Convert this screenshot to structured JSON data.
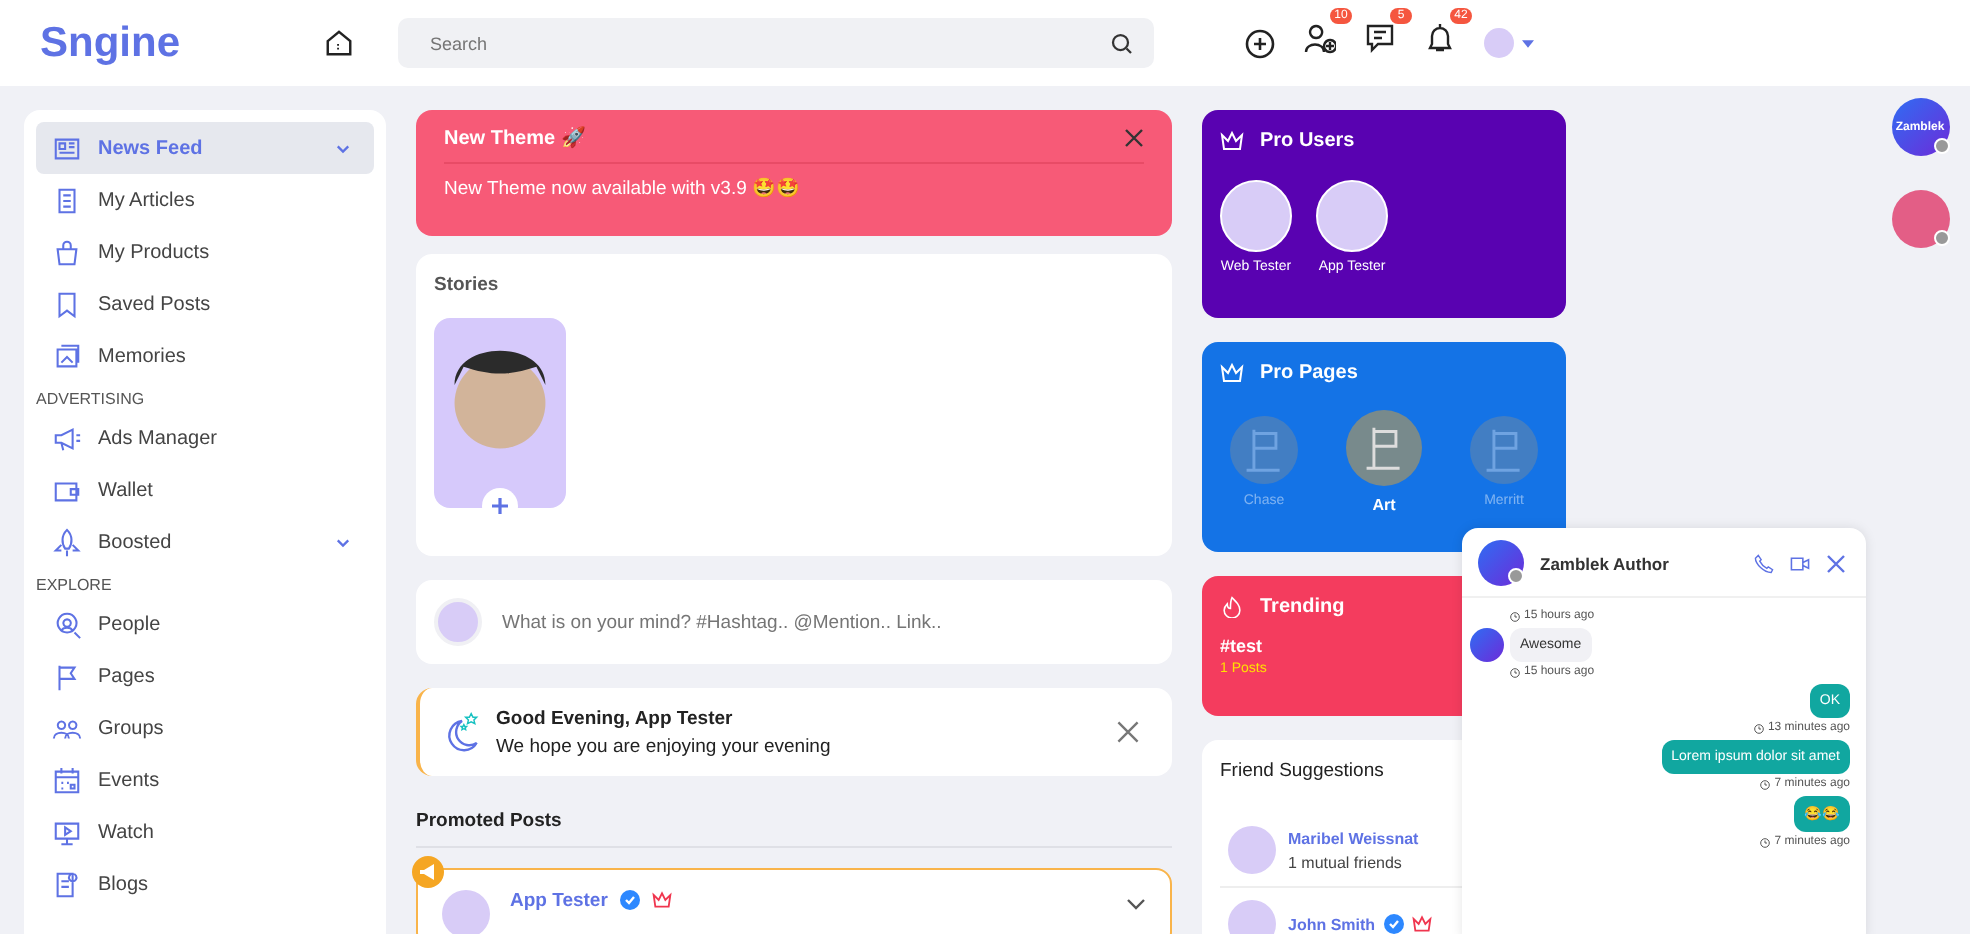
{
  "header": {
    "logo": "Sngine",
    "search": {
      "placeholder": "Search"
    },
    "badges": [
      "10",
      "5",
      "42"
    ]
  },
  "sidebar": {
    "sections": [
      {
        "items": [
          {
            "label": "News Feed",
            "selected": true,
            "expandable": true
          },
          {
            "label": "My Articles",
            "selected": false,
            "expandable": false
          },
          {
            "label": "My Products",
            "selected": false,
            "expandable": false
          },
          {
            "label": "Saved Posts",
            "selected": false,
            "expandable": false
          },
          {
            "label": "Memories",
            "selected": false,
            "expandable": false
          }
        ]
      },
      {
        "title": "ADVERTISING",
        "items": [
          {
            "label": "Ads Manager",
            "selected": false,
            "expandable": false
          },
          {
            "label": "Wallet",
            "selected": false,
            "expandable": false
          },
          {
            "label": "Boosted",
            "selected": false,
            "expandable": true
          }
        ]
      },
      {
        "title": "EXPLORE",
        "items": [
          {
            "label": "People",
            "selected": false,
            "expandable": false
          },
          {
            "label": "Pages",
            "selected": false,
            "expandable": false
          },
          {
            "label": "Groups",
            "selected": false,
            "expandable": false
          },
          {
            "label": "Events",
            "selected": false,
            "expandable": false
          },
          {
            "label": "Watch",
            "selected": false,
            "expandable": false
          },
          {
            "label": "Blogs",
            "selected": false,
            "expandable": false
          }
        ]
      }
    ]
  },
  "announcement": {
    "title": "New Theme 🚀",
    "text": "New Theme now available with v3.9 🤩🤩"
  },
  "stories": {
    "title": "Stories"
  },
  "composer": {
    "placeholder": "What is on your mind? #Hashtag.. @Mention.. Link.."
  },
  "greeting": {
    "title": "Good Evening, App Tester",
    "text": "We hope you are enjoying your evening"
  },
  "promoted": {
    "title": "Promoted Posts",
    "post": {
      "author": "App Tester",
      "verified": true,
      "pro": true
    }
  },
  "pro_users": {
    "title": "Pro Users",
    "users": [
      "Web Tester",
      "App Tester"
    ]
  },
  "pro_pages": {
    "title": "Pro Pages",
    "pages": [
      {
        "name": "Chase",
        "selected": false
      },
      {
        "name": "Art",
        "selected": true
      },
      {
        "name": "Merritt",
        "selected": false
      }
    ]
  },
  "trending": {
    "title": "Trending",
    "tag": "#test",
    "count": "1 Posts"
  },
  "friend_suggestions": {
    "title": "Friend Suggestions",
    "people": [
      {
        "name": "Maribel Weissnat",
        "mutual": "1 mutual friends",
        "verified": false,
        "pro": false
      },
      {
        "name": "John Smith",
        "verified": true,
        "pro": true
      }
    ]
  },
  "chat_avatars": [
    {
      "label": "Zamblek",
      "kind": "logo"
    },
    {
      "kind": "photo"
    }
  ],
  "chat": {
    "name": "Zamblek Author",
    "messages": [
      {
        "kind": "incoming",
        "time": "15 hours ago"
      },
      {
        "kind": "incoming",
        "text": "Awesome",
        "time": "15 hours ago"
      },
      {
        "kind": "outgoing",
        "text": "OK",
        "time": "13 minutes ago"
      },
      {
        "kind": "outgoing",
        "text": "Lorem ipsum dolor sit amet",
        "time": "7 minutes ago"
      },
      {
        "kind": "outgoing",
        "text": "😂😂",
        "time": "7 minutes ago"
      }
    ]
  }
}
